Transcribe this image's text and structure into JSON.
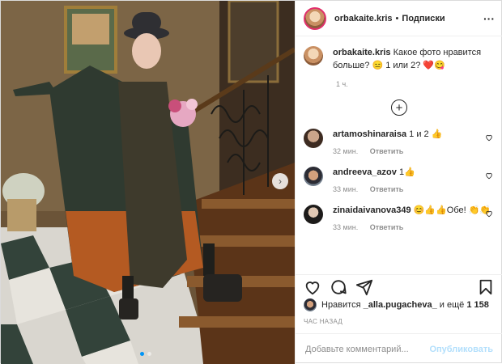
{
  "colors": {
    "accent": "#0095f6",
    "text": "#262626",
    "muted": "#8e8e8e",
    "heart": "#ed4956",
    "publish_disabled": "#b2dffc"
  },
  "post": {
    "username": "orbakaite.kris",
    "follow_label": "Подписки",
    "more_icon": "ellipsis-icon",
    "caption_user": "orbakaite.kris",
    "caption_text": "Какое фото нравится больше? 😑 1 или 2? ❤️😋",
    "caption_time": "1 ч.",
    "carousel": {
      "current_slide": 1,
      "total_slides": 2
    }
  },
  "comments": [
    {
      "user": "artamoshinaraisa",
      "text": "1 и 2 👍",
      "time": "32 мин.",
      "reply": "Ответить"
    },
    {
      "user": "andreeva_azov",
      "text": "1👍",
      "time": "33 мин.",
      "reply": "Ответить"
    },
    {
      "user": "zinaidaivanova349",
      "text": "😊👍👍Обе! 👏👏",
      "time": "33 мин.",
      "reply": "Ответить"
    }
  ],
  "likes": {
    "prefix": "Нравится",
    "liker": "_alla.pugacheva_",
    "suffix": "и ещё",
    "count": "1 158"
  },
  "posted_ago": "ЧАС НАЗАД",
  "add_comment": {
    "placeholder": "Добавьте комментарий...",
    "publish_label": "Опубликовать"
  }
}
